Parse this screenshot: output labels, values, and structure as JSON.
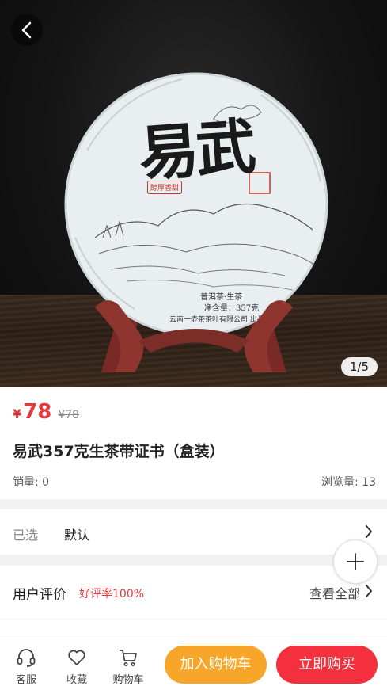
{
  "hero": {
    "image_counter": "1/5",
    "cake_text": {
      "brand_big": "易武",
      "seal_small": "醇厚香甜",
      "line1": "普洱茶·生茶",
      "line2": "净含量：357克",
      "line3": "云南一壶茶茶叶有限公司 出品"
    }
  },
  "product": {
    "currency": "¥",
    "price": "78",
    "original_price": "¥78",
    "title": "易武357克生茶带证书（盒装）",
    "sales": "销量: 0",
    "views": "浏览量: 13"
  },
  "spec": {
    "label": "已选",
    "value": "默认"
  },
  "reviews": {
    "title": "用户评价",
    "rate": "好评率100%",
    "view_all": "查看全部"
  },
  "bottom_bar": {
    "service": "客服",
    "favorite": "收藏",
    "cart": "购物车",
    "add_to_cart": "加入购物车",
    "buy_now": "立即购买"
  },
  "colors": {
    "accent_red": "#e4393c",
    "cart_orange": "#f7a629",
    "buy_red": "#f4303f"
  },
  "icons": [
    "back-icon",
    "plus-icon",
    "chevron-right-icon",
    "headset-icon",
    "heart-icon",
    "cart-icon"
  ]
}
